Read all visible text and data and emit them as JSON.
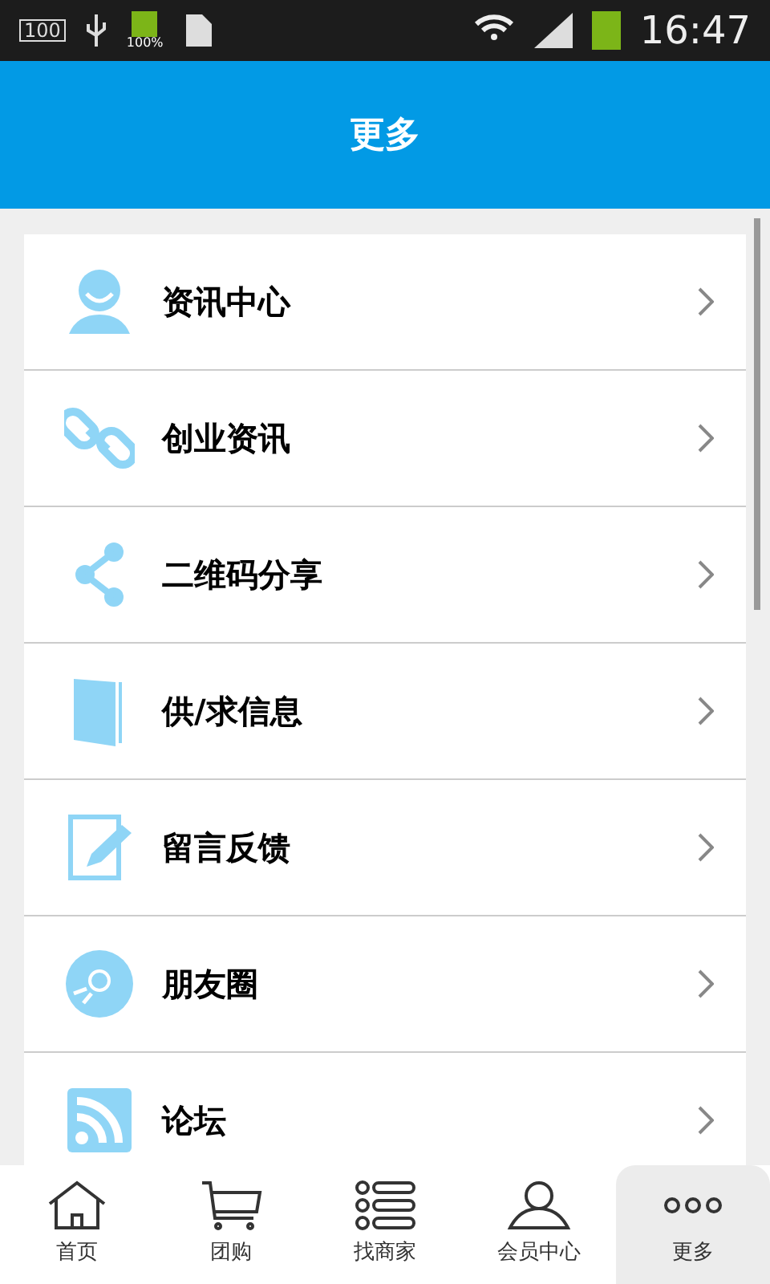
{
  "status_bar": {
    "storage_badge": "100",
    "battery_label": "100%",
    "time": "16:47"
  },
  "header": {
    "title": "更多"
  },
  "menu": [
    {
      "label": "资讯中心"
    },
    {
      "label": "创业资讯"
    },
    {
      "label": "二维码分享"
    },
    {
      "label": "供/求信息"
    },
    {
      "label": "留言反馈"
    },
    {
      "label": "朋友圈"
    },
    {
      "label": "论坛"
    }
  ],
  "tab_bar": [
    {
      "label": "首页",
      "selected": false
    },
    {
      "label": "团购",
      "selected": false
    },
    {
      "label": "找商家",
      "selected": false
    },
    {
      "label": "会员中心",
      "selected": false
    },
    {
      "label": "更多",
      "selected": true
    }
  ]
}
